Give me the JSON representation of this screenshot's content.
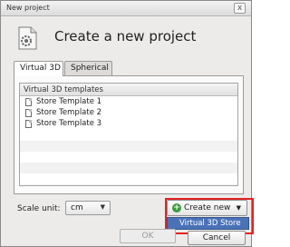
{
  "window": {
    "title": "New project",
    "close_glyph": "x"
  },
  "header": {
    "heading": "Create a new project",
    "icon": "settings-document-icon"
  },
  "tabs": [
    {
      "label": "Virtual 3D",
      "active": true
    },
    {
      "label": "Spherical",
      "active": false
    }
  ],
  "templates": {
    "column_header": "Virtual 3D templates",
    "items": [
      {
        "label": "Store Template 1",
        "icon": "document-icon"
      },
      {
        "label": "Store Template 2",
        "icon": "document-icon"
      },
      {
        "label": "Store Template 3",
        "icon": "document-icon"
      }
    ]
  },
  "scale": {
    "label": "Scale unit:",
    "value": "cm"
  },
  "create_new": {
    "label": "Create new",
    "icon": "plus-icon",
    "menu_items": [
      "Virtual 3D Store"
    ]
  },
  "footer": {
    "ok_label": "OK",
    "cancel_label": "Cancel"
  },
  "colors": {
    "accent": "#4a72b8",
    "highlight_border": "#e02323",
    "plus": "#3d9a3d"
  }
}
